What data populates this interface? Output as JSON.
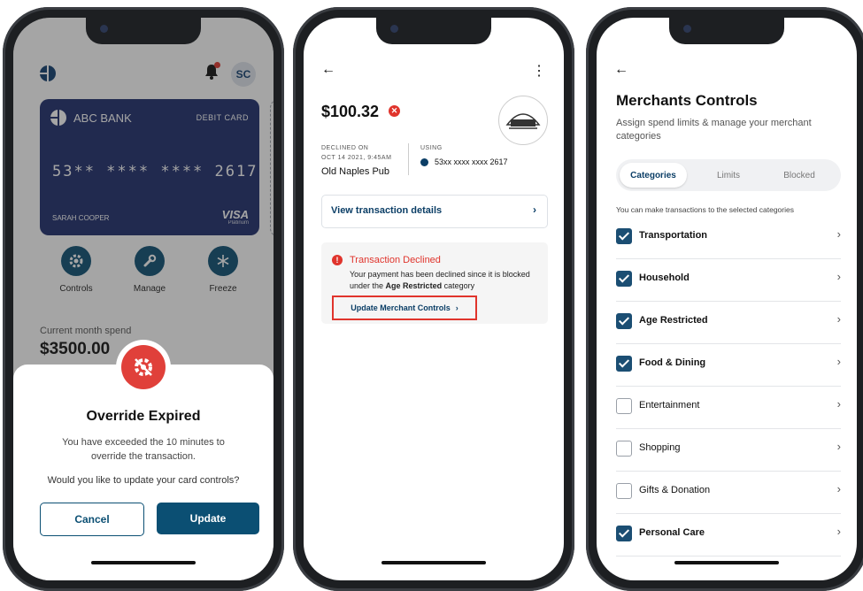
{
  "phone1": {
    "avatar": "SC",
    "card": {
      "bank_name": "ABC BANK",
      "card_type": "DEBIT CARD",
      "number": "53** **** **** 2617",
      "holder": "SARAH COOPER",
      "network": "VISA",
      "tier": "Platinum"
    },
    "actions": [
      {
        "label": "Controls",
        "icon": "gear-icon"
      },
      {
        "label": "Manage",
        "icon": "wrench-icon"
      },
      {
        "label": "Freeze",
        "icon": "snowflake-icon"
      }
    ],
    "spend_label": "Current month spend",
    "spend_value": "$3500.00",
    "modal": {
      "icon": "blocked-gear-icon",
      "title": "Override Expired",
      "message": "You have exceeded the 10 minutes to override the transaction.",
      "question": "Would you like to update your card controls?",
      "cancel_label": "Cancel",
      "update_label": "Update"
    }
  },
  "phone2": {
    "amount": "$100.32",
    "declined_caption": "DECLINED ON",
    "declined_date": "OCT 14 2021, 9:45AM",
    "merchant": "Old Naples Pub",
    "using_caption": "USING",
    "using_card": "53xx xxxx xxxx 2617",
    "view_details": "View transaction details",
    "alert_title": "Transaction Declined",
    "alert_msg_prefix": "Your payment has been declined since it is blocked under the",
    "alert_category": "Age Restricted",
    "alert_msg_suffix": "category",
    "alert_link": "Update Merchant Controls",
    "accent_red": "#e0342c"
  },
  "phone3": {
    "title": "Merchants Controls",
    "subtitle": "Assign spend limits & manage your merchant categories",
    "tabs": [
      "Categories",
      "Limits",
      "Blocked"
    ],
    "active_tab": "Categories",
    "hint": "You can make transactions to the selected categories",
    "categories": [
      {
        "name": "Transportation",
        "checked": true
      },
      {
        "name": "Household",
        "checked": true
      },
      {
        "name": "Age Restricted",
        "checked": true
      },
      {
        "name": "Food & Dining",
        "checked": true
      },
      {
        "name": "Entertainment",
        "checked": false
      },
      {
        "name": "Shopping",
        "checked": false
      },
      {
        "name": "Gifts & Donation",
        "checked": false
      },
      {
        "name": "Personal Care",
        "checked": true
      }
    ]
  }
}
